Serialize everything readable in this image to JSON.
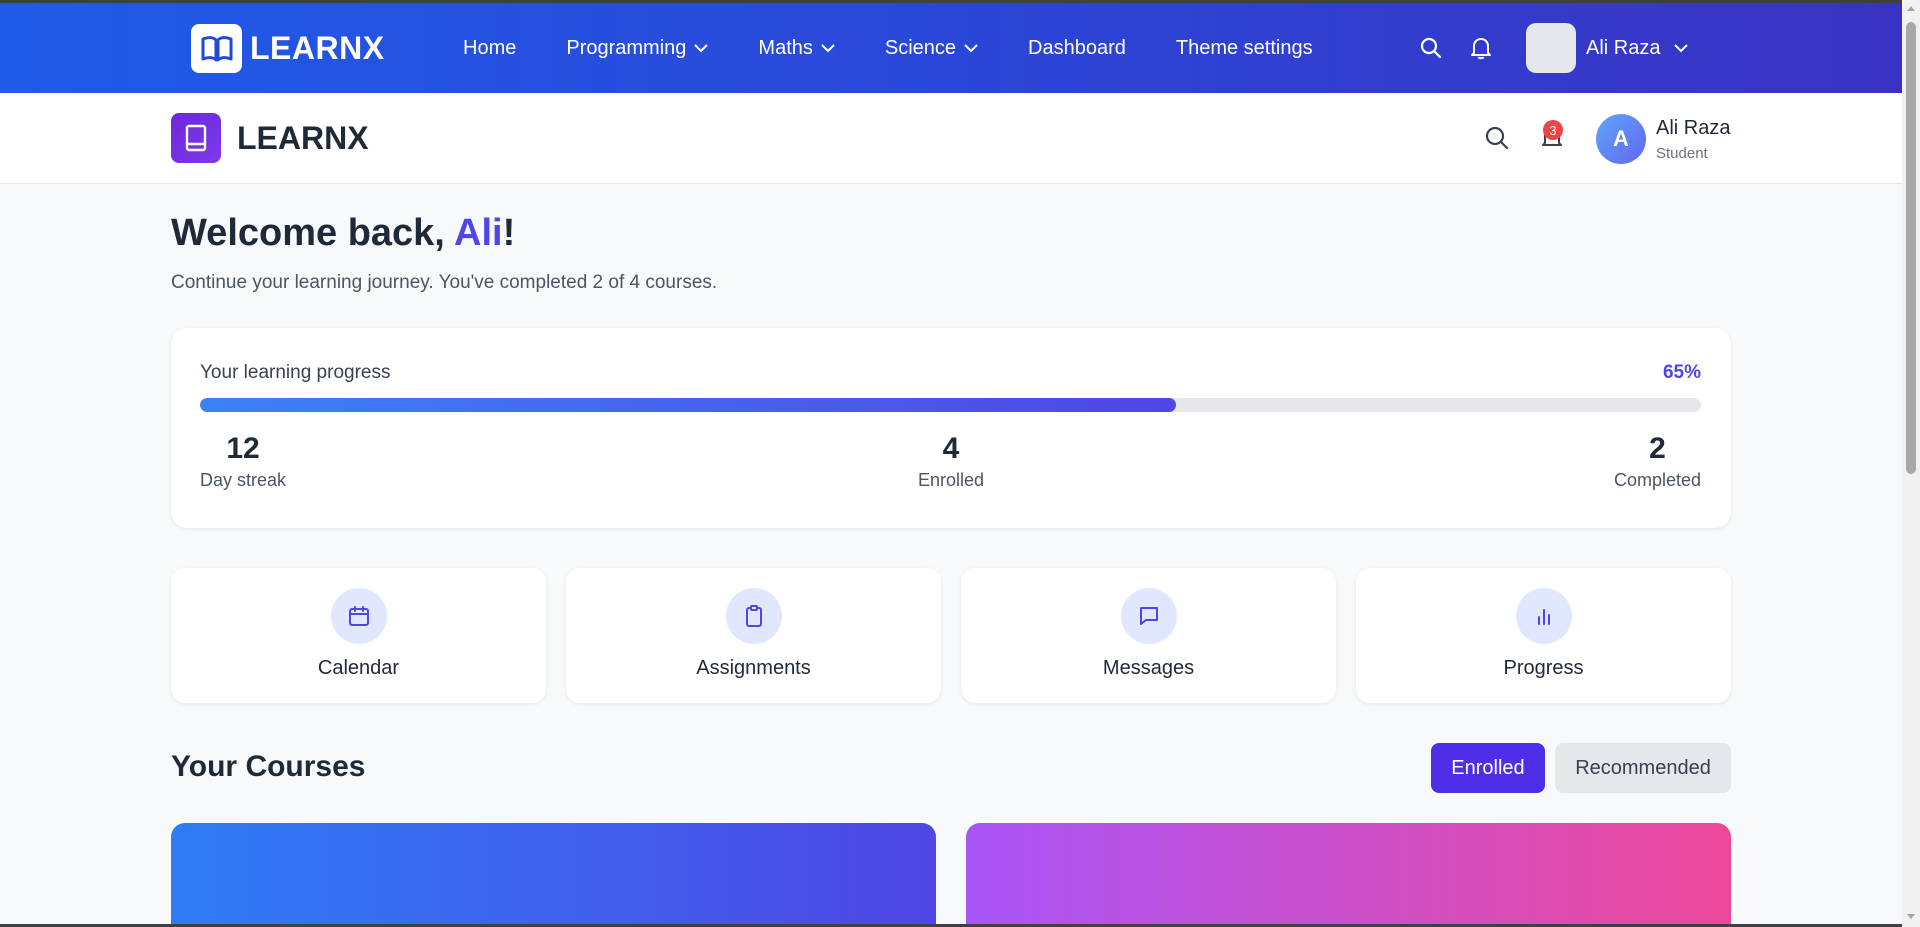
{
  "topnav": {
    "brand": "LEARNX",
    "links": [
      {
        "label": "Home"
      },
      {
        "label": "Programming"
      },
      {
        "label": "Maths"
      },
      {
        "label": "Science"
      },
      {
        "label": "Dashboard"
      },
      {
        "label": "Theme settings"
      }
    ],
    "user_name": "Ali Raza"
  },
  "subheader": {
    "brand": "LEARNX",
    "notification_count": "3",
    "avatar_initial": "A",
    "user_name": "Ali Raza",
    "user_role": "Student"
  },
  "welcome": {
    "prefix": "Welcome back, ",
    "name": "Ali",
    "suffix": "!",
    "subtitle": "Continue your learning journey. You've completed 2 of 4 courses."
  },
  "progress": {
    "label": "Your learning progress",
    "percent_text": "65%",
    "percent": 65,
    "stats": [
      {
        "value": "12",
        "label": "Day streak"
      },
      {
        "value": "4",
        "label": "Enrolled"
      },
      {
        "value": "2",
        "label": "Completed"
      }
    ]
  },
  "tiles": [
    {
      "label": "Calendar",
      "icon": "calendar-icon"
    },
    {
      "label": "Assignments",
      "icon": "clipboard-icon"
    },
    {
      "label": "Messages",
      "icon": "message-icon"
    },
    {
      "label": "Progress",
      "icon": "bar-chart-icon"
    }
  ],
  "courses": {
    "title": "Your Courses",
    "tab_enrolled": "Enrolled",
    "tab_recommended": "Recommended"
  },
  "colors": {
    "accent": "#4f46e5",
    "nav_gradient_start": "#1f5be8",
    "nav_gradient_end": "#3a32c2",
    "badge": "#ef4444"
  }
}
